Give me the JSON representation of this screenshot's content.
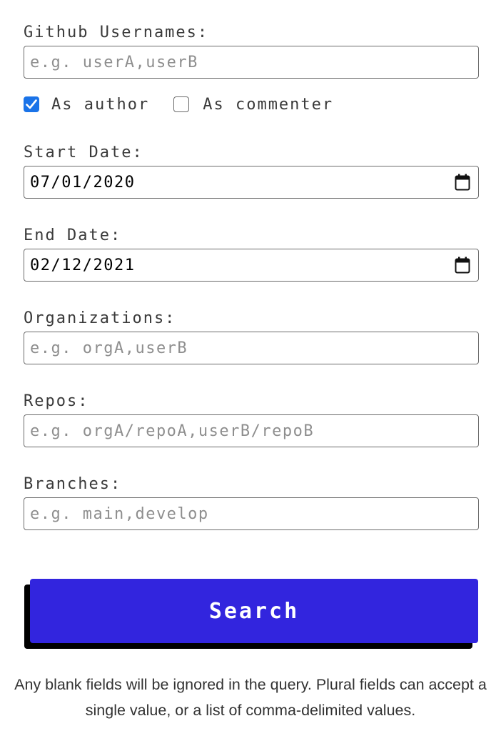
{
  "usernames": {
    "label": "Github Usernames:",
    "placeholder": "e.g. userA,userB",
    "value": ""
  },
  "roles": {
    "author": {
      "label": "As author",
      "checked": true
    },
    "commenter": {
      "label": "As commenter",
      "checked": false
    }
  },
  "start_date": {
    "label": "Start Date:",
    "value": "07/01/2020",
    "icon": "calendar-icon"
  },
  "end_date": {
    "label": "End Date:",
    "value": "02/12/2021",
    "icon": "calendar-icon"
  },
  "organizations": {
    "label": "Organizations:",
    "placeholder": "e.g. orgA,userB",
    "value": ""
  },
  "repos": {
    "label": "Repos:",
    "placeholder": "e.g. orgA/repoA,userB/repoB",
    "value": ""
  },
  "branches": {
    "label": "Branches:",
    "placeholder": "e.g. main,develop",
    "value": ""
  },
  "search_button": {
    "label": "Search",
    "color": "#3225de",
    "shadow_color": "#000000"
  },
  "help_text": "Any blank fields will be ignored in the query. Plural fields can accept a single value, or a list of comma-delimited values.",
  "colors": {
    "checkbox_checked": "#1a73e8",
    "border": "#6b6b6b",
    "placeholder": "#8e8e8e"
  }
}
